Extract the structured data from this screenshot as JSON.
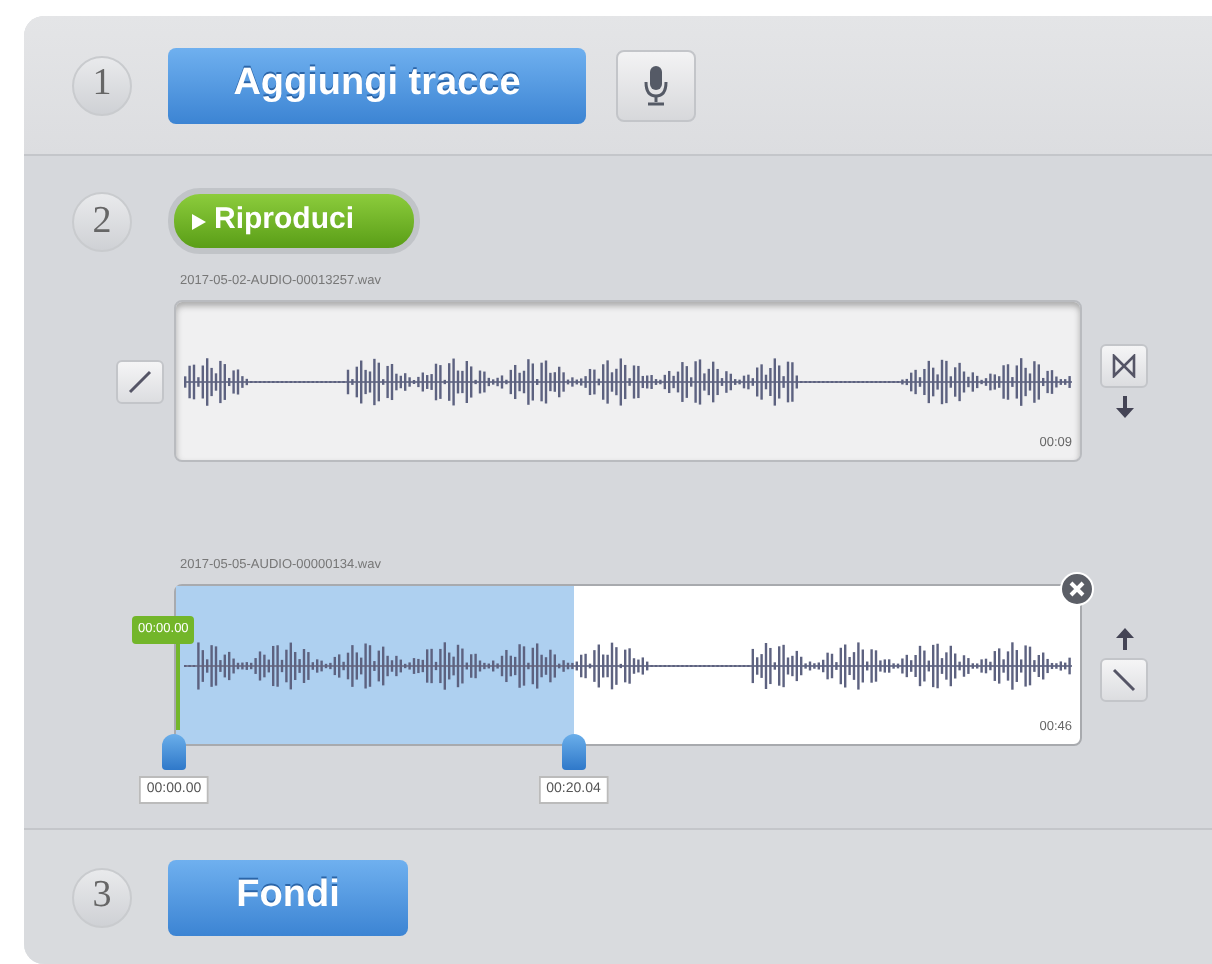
{
  "steps": [
    {
      "number": "1",
      "kind": "add",
      "button": "Aggiungi tracce"
    },
    {
      "number": "2",
      "kind": "tracks",
      "button": "Riproduci"
    },
    {
      "number": "3",
      "kind": "merge",
      "button": "Fondi"
    }
  ],
  "tracks": [
    {
      "filename": "2017-05-02-AUDIO-00013257.wav",
      "duration": "00:09",
      "selected": false
    },
    {
      "filename": "2017-05-05-AUDIO-00000134.wav",
      "duration": "00:46",
      "selected": true,
      "level": 0.44,
      "start_marker": "00:00.00",
      "start_label": "00:00.00",
      "end_label": "00:20.04"
    }
  ]
}
